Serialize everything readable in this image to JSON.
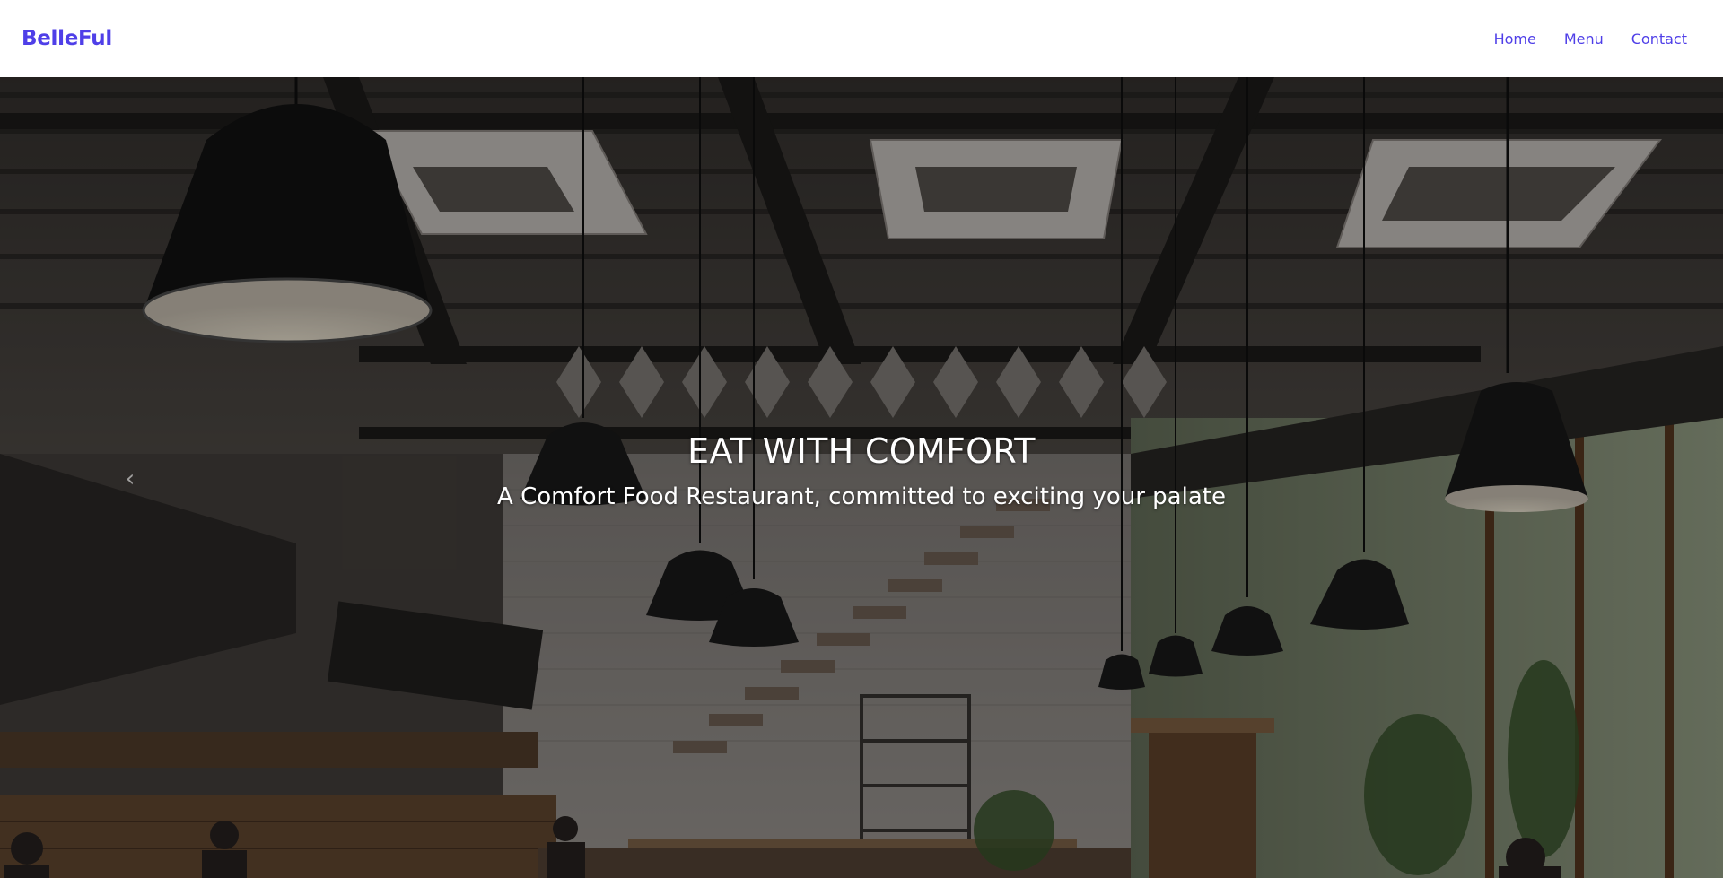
{
  "brand": {
    "name": "BelleFul"
  },
  "nav": {
    "items": [
      {
        "label": "Home"
      },
      {
        "label": "Menu"
      },
      {
        "label": "Contact"
      }
    ]
  },
  "hero": {
    "title": "EAT WITH COMFORT",
    "subtitle": "A Comfort Food Restaurant, committed to exciting your palate",
    "prev_icon": "chevron-left-icon"
  },
  "colors": {
    "brand": "#4f3fe8",
    "text_on_hero": "#ffffff",
    "navbar_bg": "#ffffff"
  }
}
